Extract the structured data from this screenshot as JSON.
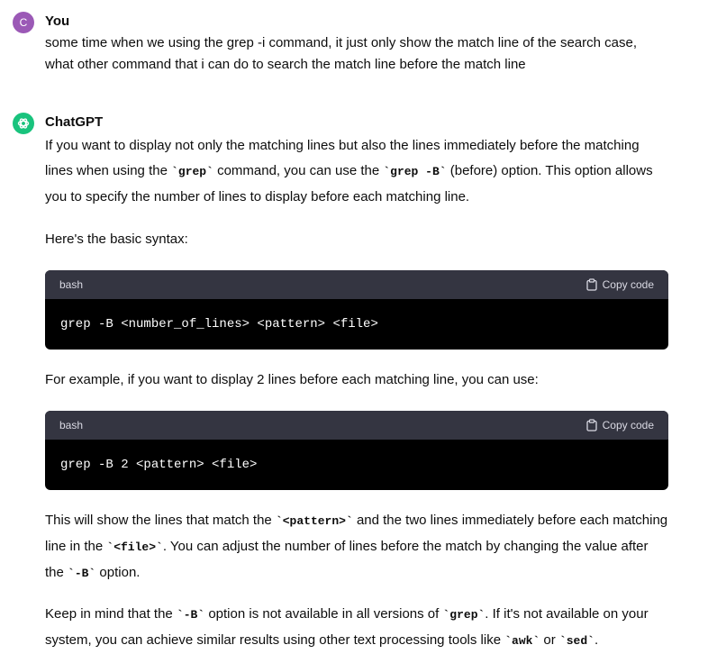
{
  "user": {
    "avatar_letter": "C",
    "name": "You",
    "message": "some time when we using the grep -i command, it just only show the match line of the search case, what other command that i can  do to search the match line before the match line"
  },
  "assistant": {
    "name": "ChatGPT",
    "p1": {
      "a": "If you want to display not only the matching lines but also the lines immediately before the matching lines when using the ",
      "code1": "`grep`",
      "b": " command, you can use the ",
      "code2": "`grep -B`",
      "c": " (before) option. This option allows you to specify the number of lines to display before each matching line."
    },
    "p2": "Here's the basic syntax:",
    "code_block_1": {
      "language": "bash",
      "copy_label": "Copy code",
      "code": "grep -B <number_of_lines> <pattern> <file>"
    },
    "p3": "For example, if you want to display 2 lines before each matching line, you can use:",
    "code_block_2": {
      "language": "bash",
      "copy_label": "Copy code",
      "code": "grep -B 2 <pattern> <file>"
    },
    "p4": {
      "a": "This will show the lines that match the ",
      "code1": "`<pattern>`",
      "b": " and the two lines immediately before each matching line in the ",
      "code2": "`<file>`",
      "c": ". You can adjust the number of lines before the match by changing the value after the ",
      "code3": "`-B`",
      "d": " option."
    },
    "p5": {
      "a": "Keep in mind that the ",
      "code1": "`-B`",
      "b": " option is not available in all versions of ",
      "code2": "`grep`",
      "c": ". If it's not available on your system, you can achieve similar results using other text processing tools like ",
      "code3": "`awk`",
      "d": " or ",
      "code4": "`sed`",
      "e": "."
    }
  }
}
